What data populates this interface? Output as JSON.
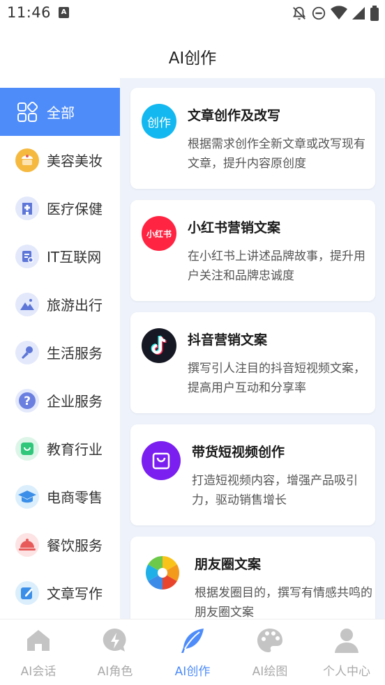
{
  "status_bar": {
    "time": "11:46",
    "notif_glyph": "A"
  },
  "header": {
    "title": "AI创作"
  },
  "sidebar": {
    "items": [
      {
        "label": "全部",
        "icon": "grid-icon"
      },
      {
        "label": "美容美妆",
        "icon": "cake-icon"
      },
      {
        "label": "医疗保健",
        "icon": "hospital-icon"
      },
      {
        "label": "IT互联网",
        "icon": "document-icon"
      },
      {
        "label": "旅游出行",
        "icon": "mountain-icon"
      },
      {
        "label": "生活服务",
        "icon": "microphone-icon"
      },
      {
        "label": "企业服务",
        "icon": "question-icon"
      },
      {
        "label": "教育行业",
        "icon": "bag-icon"
      },
      {
        "label": "电商零售",
        "icon": "graduation-cap-icon"
      },
      {
        "label": "餐饮服务",
        "icon": "cloche-icon"
      },
      {
        "label": "文章写作",
        "icon": "edit-icon"
      }
    ]
  },
  "cards": [
    {
      "title": "文章创作及改写",
      "desc": "根据需求创作全新文章或改写现有文章，提升内容原创度",
      "icon_text": "创作"
    },
    {
      "title": "小红书营销文案",
      "desc": "在小红书上讲述品牌故事，提升用户关注和品牌忠诚度",
      "icon_text": "小红书"
    },
    {
      "title": "抖音营销文案",
      "desc": "撰写引人注目的抖音短视频文案，提高用户互动和分享率",
      "icon_text": ""
    },
    {
      "title": "带货短视频创作",
      "desc": "打造短视频内容，增强产品吸引力，驱动销售增长",
      "icon_text": ""
    },
    {
      "title": "朋友圈文案",
      "desc": "根据发圈目的，撰写有情感共鸣的朋友圈文案",
      "icon_text": ""
    }
  ],
  "bottom_nav": {
    "items": [
      {
        "label": "AI会话",
        "icon": "home-icon"
      },
      {
        "label": "AI角色",
        "icon": "lightning-icon"
      },
      {
        "label": "AI创作",
        "icon": "feather-icon"
      },
      {
        "label": "AI绘图",
        "icon": "palette-icon"
      },
      {
        "label": "个人中心",
        "icon": "user-icon"
      }
    ]
  },
  "colors": {
    "accent": "#4e8cfa",
    "content_bg": "#eef3fb",
    "nav_inactive": "#aaaaaa"
  }
}
